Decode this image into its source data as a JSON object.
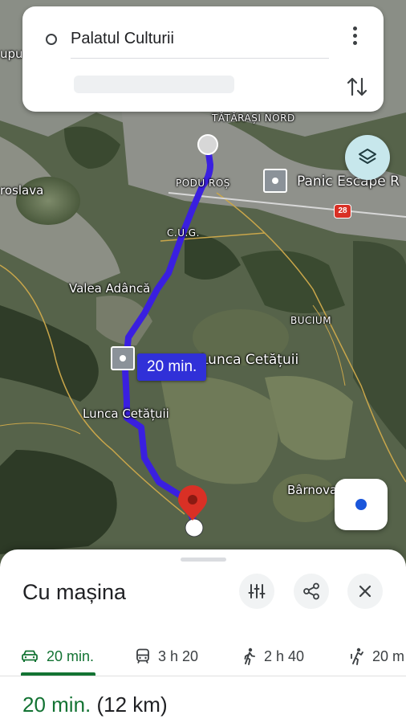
{
  "search": {
    "origin": "Palatul Culturii"
  },
  "map": {
    "labels": {
      "tatarasi": "TĂTĂRAȘI NORD",
      "podu_ros": "PODU ROȘ",
      "panic": "Panic Escape R",
      "road_number": "28",
      "cug": "C.U.G.",
      "valea": "Valea Adâncă",
      "bucium": "BUCIUM",
      "lunca_right": "Lunca Cetățuii",
      "lunca_left": "Lunca Cetățuii",
      "barnova": "Bârnova",
      "roslava": "roslava",
      "upu": "upu"
    },
    "eta": "20 min.",
    "route_color": "#3a1fe0",
    "destination_color": "#d93025"
  },
  "sheet": {
    "title": "Cu mașina",
    "modes": [
      {
        "icon": "car-icon",
        "label": "20 min."
      },
      {
        "icon": "transit-icon",
        "label": "3 h 20"
      },
      {
        "icon": "walk-icon",
        "label": "2 h 40"
      },
      {
        "icon": "rideshare-icon",
        "label": "20 m"
      }
    ],
    "summary_time": "20 min.",
    "summary_distance": "(12 km)"
  },
  "colors": {
    "accent_green": "#137333",
    "eta_blue": "#3030d8"
  }
}
